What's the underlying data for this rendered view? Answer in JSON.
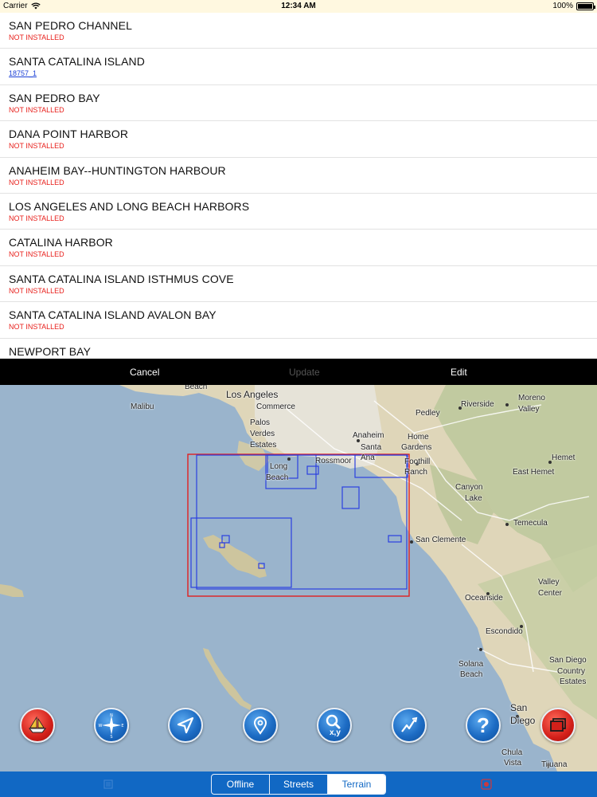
{
  "status_bar": {
    "carrier": "Carrier",
    "time": "12:34 AM",
    "battery": "100%",
    "battery_level": 1.0
  },
  "charts": [
    {
      "name": "SAN PEDRO CHANNEL",
      "status": "NOT INSTALLED",
      "installed": false
    },
    {
      "name": "SANTA CATALINA ISLAND",
      "status": "18757_1",
      "installed": true
    },
    {
      "name": "SAN PEDRO BAY",
      "status": "NOT INSTALLED",
      "installed": false
    },
    {
      "name": "DANA POINT HARBOR",
      "status": "NOT INSTALLED",
      "installed": false
    },
    {
      "name": "ANAHEIM BAY--HUNTINGTON HARBOUR",
      "status": "NOT INSTALLED",
      "installed": false
    },
    {
      "name": "LOS ANGELES AND LONG BEACH HARBORS",
      "status": "NOT INSTALLED",
      "installed": false
    },
    {
      "name": "CATALINA HARBOR",
      "status": "NOT INSTALLED",
      "installed": false
    },
    {
      "name": "SANTA CATALINA ISLAND ISTHMUS COVE",
      "status": "NOT INSTALLED",
      "installed": false
    },
    {
      "name": "SANTA CATALINA ISLAND AVALON BAY",
      "status": "NOT INSTALLED",
      "installed": false
    },
    {
      "name": "NEWPORT BAY",
      "status": "",
      "installed": false
    }
  ],
  "toolbar": {
    "cancel": "Cancel",
    "update": "Update",
    "edit": "Edit"
  },
  "map": {
    "labels": {
      "beach": "Beach",
      "malibu": "Malibu",
      "los_angeles": "Los Angeles",
      "commerce": "Commerce",
      "palos": "Palos",
      "verdes": "Verdes",
      "estates": "Estates",
      "long": "Long",
      "beach2": "Beach",
      "rossmoor": "Rossmoor",
      "anaheim": "Anaheim",
      "santa": "Santa",
      "ana": "Ana",
      "home": "Home",
      "gardens": "Gardens",
      "foothill": "Foothill",
      "ranch": "Ranch",
      "pedley": "Pedley",
      "riverside": "Riverside",
      "moreno": "Moreno",
      "valley": "Valley",
      "hemet": "Hemet",
      "east_hemet": "East Hemet",
      "canyon": "Canyon",
      "lake": "Lake",
      "temecula": "Temecula",
      "san_clemente": "San Clemente",
      "valley2": "Valley",
      "center": "Center",
      "oceanside": "Oceanside",
      "escondido": "Escondido",
      "solana": "Solana",
      "beach3": "Beach",
      "san_diego_country": "San Diego",
      "country": "Country",
      "estates2": "Estates",
      "san": "San",
      "diego": "Diego",
      "chula": "Chula",
      "vista": "Vista",
      "tijuana": "Tijuana"
    }
  },
  "tools": [
    {
      "id": "boat",
      "icon": "sailboat-icon"
    },
    {
      "id": "compass",
      "icon": "compass-icon"
    },
    {
      "id": "locate",
      "icon": "navigation-arrow-icon"
    },
    {
      "id": "pin",
      "icon": "map-pin-icon"
    },
    {
      "id": "search-xy",
      "icon": "search-coordinates-icon",
      "text": "x,y"
    },
    {
      "id": "route",
      "icon": "route-icon"
    },
    {
      "id": "help",
      "icon": "help-icon",
      "text": "?"
    },
    {
      "id": "layers",
      "icon": "layers-icon"
    }
  ],
  "tabs": {
    "offline": "Offline",
    "streets": "Streets",
    "terrain": "Terrain",
    "selected": "Terrain"
  },
  "colors": {
    "not_installed": "#e8201c",
    "installed": "#1a3fd6",
    "tab_bar": "#1168c4",
    "coverage_outer": "#e02020",
    "coverage_inner": "#2b3fe0"
  }
}
